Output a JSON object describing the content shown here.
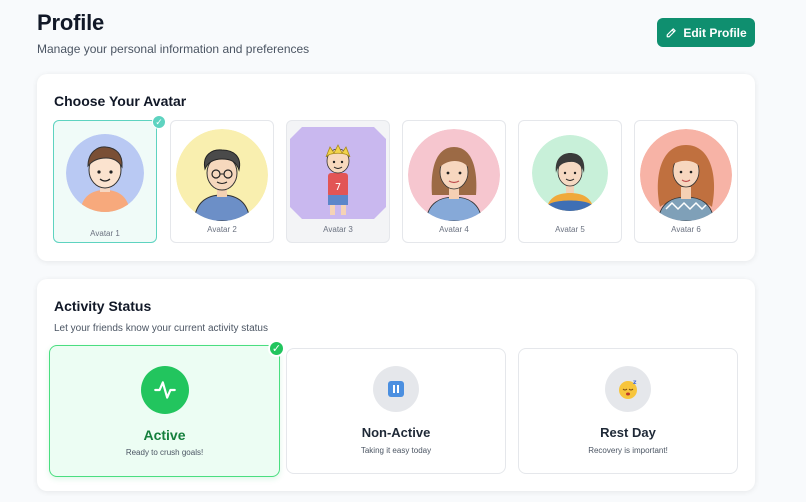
{
  "header": {
    "title": "Profile",
    "subtitle": "Manage your personal information and preferences",
    "edit_button_label": "Edit Profile",
    "edit_icon": "pencil-icon"
  },
  "avatar_section": {
    "title": "Choose Your Avatar",
    "selected_index": 0,
    "items": [
      {
        "label": "Avatar 1",
        "bg": "#b9c9f3"
      },
      {
        "label": "Avatar 2",
        "bg": "#f9efaf"
      },
      {
        "label": "Avatar 3",
        "bg": "#c9b8ef"
      },
      {
        "label": "Avatar 4",
        "bg": "#f6c6cf"
      },
      {
        "label": "Avatar 5",
        "bg": "#c8f0d9"
      },
      {
        "label": "Avatar 6",
        "bg": "#f7b3a6"
      }
    ]
  },
  "activity_section": {
    "title": "Activity Status",
    "description": "Let your friends know your current activity status",
    "selected_index": 0,
    "items": [
      {
        "label": "Active",
        "sub": "Ready to crush goals!",
        "icon": "activity-pulse-icon"
      },
      {
        "label": "Non-Active",
        "sub": "Taking it easy today",
        "icon": "pause-icon"
      },
      {
        "label": "Rest Day",
        "sub": "Recovery is important!",
        "icon": "sleeping-face-icon"
      }
    ]
  },
  "colors": {
    "brand": "#0f8f6f",
    "avatar_selected_border": "#5ed3c0",
    "active_green": "#22c55e"
  }
}
